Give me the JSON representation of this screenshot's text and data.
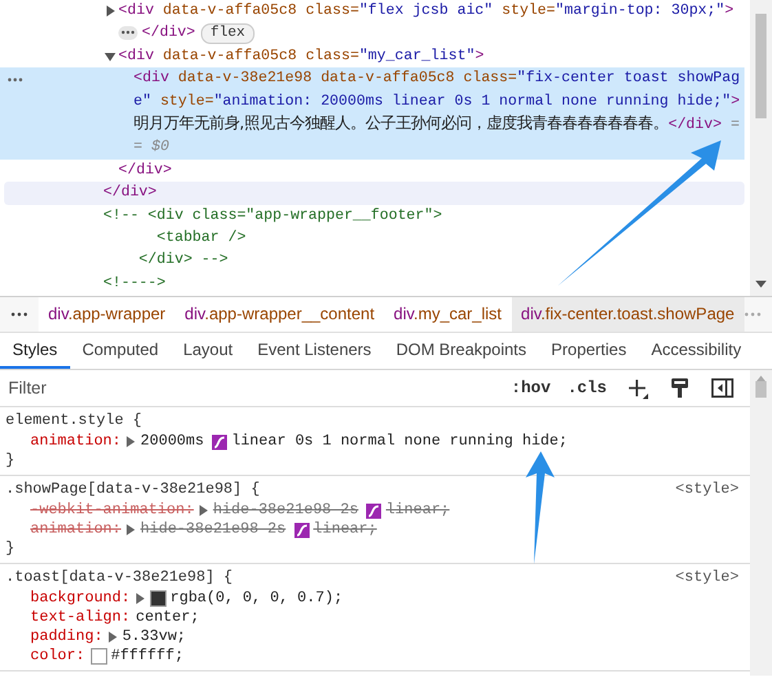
{
  "dom_tree": [
    {
      "kind": "element",
      "selected": false,
      "hovered": true,
      "close": [
        {
          "kind": "tag",
          "s": "</div>"
        }
      ],
      "children": [
        {
          "kind": "element",
          "selected": false,
          "hovered": false,
          "expanded": false,
          "open": [
            {
              "kind": "tag",
              "s": "<div"
            },
            {
              "kind": "attr",
              "s": " data-v-affa05c8"
            },
            {
              "kind": "attr",
              "s": " class="
            },
            {
              "kind": "value",
              "s": "\"flex jcsb aic\""
            },
            {
              "kind": "attr",
              "s": " style="
            },
            {
              "kind": "value",
              "s": "\"margin-top: 30px;\""
            },
            {
              "kind": "tag",
              "s": ">"
            }
          ],
          "close": [
            {
              "kind": "tag",
              "s": "</div>"
            }
          ],
          "badge": "flex"
        },
        {
          "kind": "element",
          "selected": false,
          "hovered": false,
          "expanded": true,
          "open": [
            {
              "kind": "tag",
              "s": "<div"
            },
            {
              "kind": "attr",
              "s": " data-v-affa05c8"
            },
            {
              "kind": "attr",
              "s": " class="
            },
            {
              "kind": "value",
              "s": "\"my_car_list\""
            },
            {
              "kind": "tag",
              "s": ">"
            }
          ],
          "close": [
            {
              "kind": "tag",
              "s": "</div>"
            }
          ],
          "children": [
            {
              "kind": "element",
              "selected": true,
              "hovered": false,
              "open": [
                {
                  "kind": "tag",
                  "s": "<div"
                },
                {
                  "kind": "attr",
                  "s": " data-v-38e21e98"
                },
                {
                  "kind": "attr",
                  "s": " data-v-affa05c8"
                },
                {
                  "kind": "attr",
                  "s": " class="
                },
                {
                  "kind": "value",
                  "s": "\"fix-center toast showPage\""
                },
                {
                  "kind": "attr",
                  "s": " style="
                },
                {
                  "kind": "value",
                  "s": "\"animation: 20000ms linear 0s 1 normal none running hide;\""
                },
                {
                  "kind": "tag",
                  "s": ">"
                },
                {
                  "kind": "text",
                  "s": "明月万年无前身,照见古今独醒人。公子王孙何必问，虚度我青春春春春春春春。"
                },
                {
                  "kind": "tag",
                  "s": "</div>"
                }
              ],
              "marker": " == $0"
            }
          ]
        }
      ]
    },
    {
      "kind": "comment",
      "selected": false,
      "hovered": false,
      "lines": [
        "<!-- <div class=\"app-wrapper__footer\">",
        "      <tabbar />",
        "    </div> -->"
      ]
    },
    {
      "kind": "comment",
      "selected": false,
      "hovered": false,
      "lines": [
        "<!---->"
      ]
    }
  ],
  "breadcrumbs": [
    {
      "tag": "div",
      "classes": ".app-wrapper",
      "selected": false
    },
    {
      "tag": "div",
      "classes": ".app-wrapper__content",
      "selected": false
    },
    {
      "tag": "div",
      "classes": ".my_car_list",
      "selected": false
    },
    {
      "tag": "div",
      "classes": ".fix-center.toast.showPage",
      "selected": true
    }
  ],
  "tabs": [
    {
      "label": "Styles",
      "selected": true
    },
    {
      "label": "Computed",
      "selected": false
    },
    {
      "label": "Layout",
      "selected": false
    },
    {
      "label": "Event Listeners",
      "selected": false
    },
    {
      "label": "DOM Breakpoints",
      "selected": false
    },
    {
      "label": "Properties",
      "selected": false
    },
    {
      "label": "Accessibility",
      "selected": false
    }
  ],
  "filter": {
    "placeholder": "Filter",
    "hov": ":hov",
    "cls": ".cls"
  },
  "rules": [
    {
      "selector": "element.style {",
      "close": "}",
      "declarations": [
        {
          "name": "animation:",
          "overridden": false,
          "parts": [
            {
              "kind": "expand"
            },
            {
              "kind": "text",
              "s": "20000ms"
            },
            {
              "kind": "easing"
            },
            {
              "kind": "text",
              "s": "linear 0s 1 normal none running hide;"
            }
          ]
        }
      ]
    },
    {
      "selector": ".showPage[data-v-38e21e98] {",
      "source": "<style>",
      "close": "}",
      "declarations": [
        {
          "name": "-webkit-animation:",
          "overridden": true,
          "parts": [
            {
              "kind": "expand"
            },
            {
              "kind": "text",
              "s": "hide-38e21e98 2s"
            },
            {
              "kind": "easing"
            },
            {
              "kind": "text",
              "s": "linear;"
            }
          ]
        },
        {
          "name": "animation:",
          "overridden": true,
          "parts": [
            {
              "kind": "expand"
            },
            {
              "kind": "text",
              "s": "hide-38e21e98 2s"
            },
            {
              "kind": "easing"
            },
            {
              "kind": "text",
              "s": "linear;"
            }
          ]
        }
      ]
    },
    {
      "selector": ".toast[data-v-38e21e98] {",
      "source": "<style>",
      "declarations": [
        {
          "name": "background:",
          "overridden": false,
          "parts": [
            {
              "kind": "expand"
            },
            {
              "kind": "swatch",
              "color": "#333333"
            },
            {
              "kind": "text",
              "s": "rgba(0, 0, 0, 0.7);"
            }
          ]
        },
        {
          "name": "text-align:",
          "overridden": false,
          "parts": [
            {
              "kind": "text",
              "s": "center;"
            }
          ]
        },
        {
          "name": "padding:",
          "overridden": false,
          "parts": [
            {
              "kind": "expand"
            },
            {
              "kind": "text",
              "s": "5.33vw;"
            }
          ]
        },
        {
          "name": "color:",
          "overridden": false,
          "parts": [
            {
              "kind": "swatch",
              "color": "#ffffff"
            },
            {
              "kind": "text",
              "s": "#ffffff;"
            }
          ]
        }
      ]
    }
  ]
}
